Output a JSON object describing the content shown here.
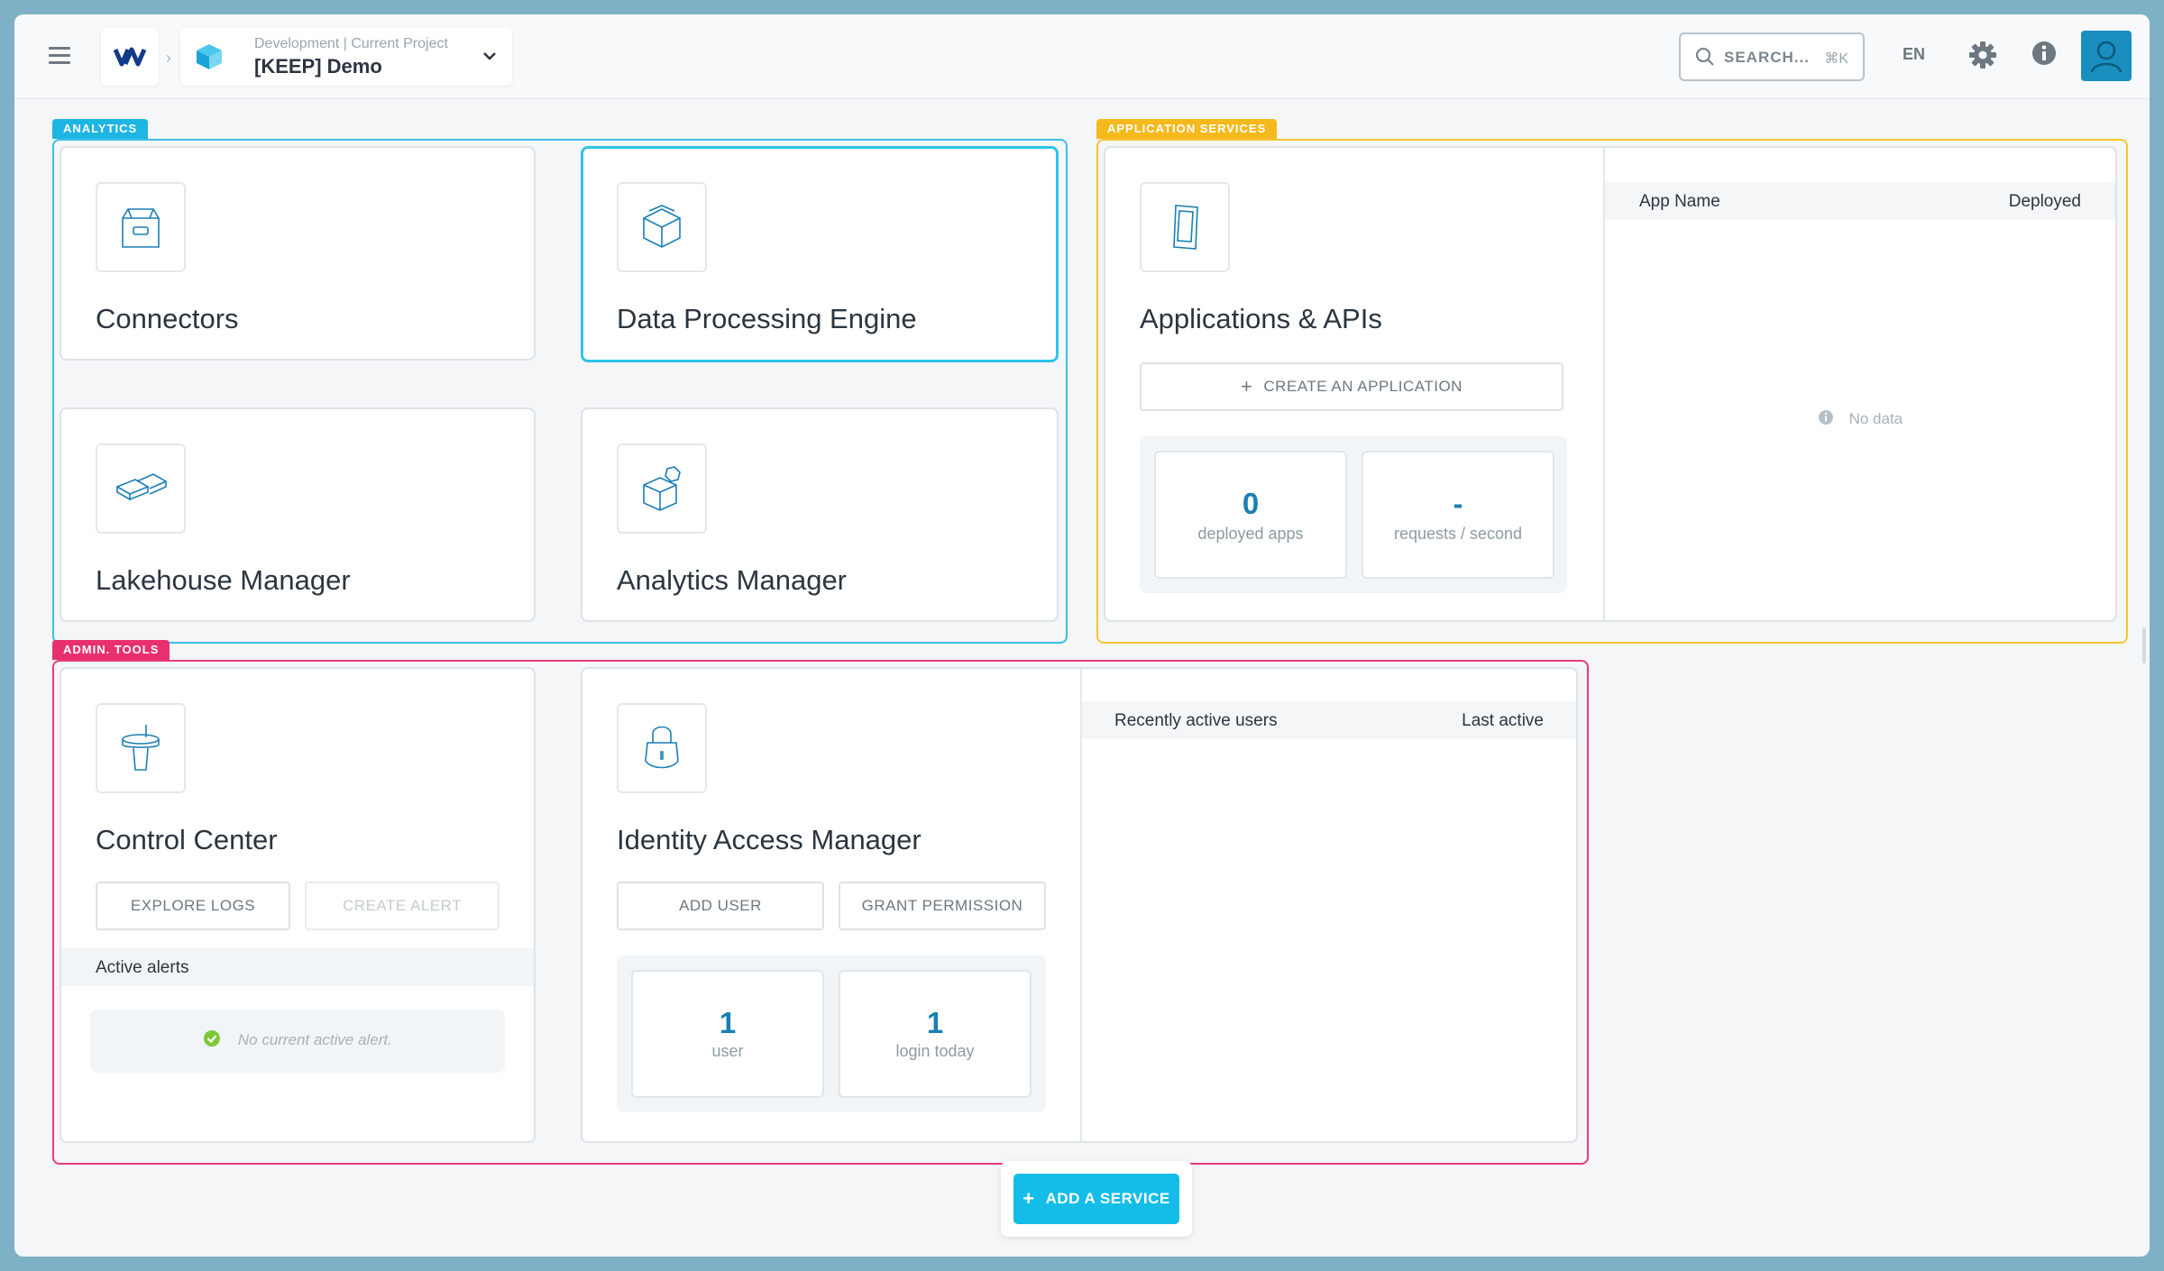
{
  "header": {
    "project_env": "Development | Current Project",
    "project_name": "[KEEP] Demo",
    "search_label": "SEARCH...",
    "search_shortcut": "⌘K",
    "language": "EN"
  },
  "groups": {
    "analytics": "ANALYTICS",
    "app_services": "APPLICATION SERVICES",
    "admin_tools": "ADMIN. TOOLS"
  },
  "analytics": {
    "connectors": "Connectors",
    "dpe": "Data Processing Engine",
    "lakehouse": "Lakehouse Manager",
    "analytics_manager": "Analytics Manager"
  },
  "apps": {
    "title": "Applications & APIs",
    "create_button": "CREATE AN APPLICATION",
    "deployed_count": "0",
    "deployed_label": "deployed apps",
    "requests_value": "-",
    "requests_label": "requests / second",
    "table": {
      "col_name": "App Name",
      "col_deployed": "Deployed",
      "empty": "No data"
    }
  },
  "control_center": {
    "title": "Control Center",
    "explore_logs": "EXPLORE LOGS",
    "create_alert": "CREATE ALERT",
    "alerts_header": "Active alerts",
    "no_alert": "No current active alert."
  },
  "iam": {
    "title": "Identity Access Manager",
    "add_user": "ADD USER",
    "grant_permission": "GRANT PERMISSION",
    "users_count": "1",
    "users_label": "user",
    "logins_count": "1",
    "logins_label": "login today",
    "table": {
      "col_users": "Recently active users",
      "col_last": "Last active"
    }
  },
  "footer": {
    "add_service": "ADD A SERVICE"
  },
  "colors": {
    "analytics": "#1eb5e3",
    "app_services": "#f5b91e",
    "admin_tools": "#e8306e",
    "accent": "#14bde8",
    "stat_number": "#1a7fb3"
  }
}
